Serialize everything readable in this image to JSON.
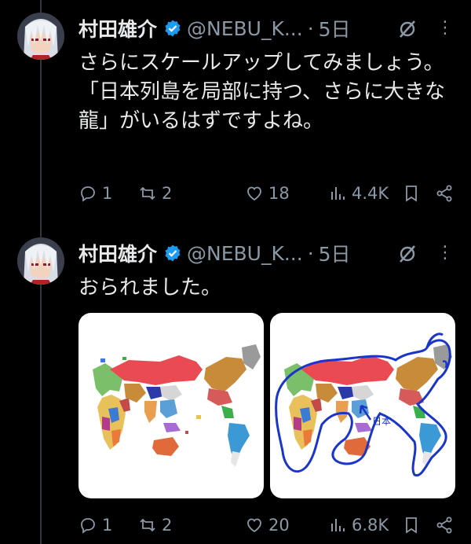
{
  "tweets": [
    {
      "author": {
        "name": "村田雄介",
        "handle": "@NEBU_K...",
        "time": "5日"
      },
      "separator": "·",
      "text": "さらにスケールアップしてみましょう。\n「日本列島を局部に持つ、さらに大きな龍」がいるはずですよね。",
      "stats": {
        "replies": "1",
        "reposts": "2",
        "likes": "18",
        "views": "4.4K"
      }
    },
    {
      "author": {
        "name": "村田雄介",
        "handle": "@NEBU_K...",
        "time": "5日"
      },
      "separator": "·",
      "text": "おられました。",
      "media_label": "日本",
      "stats": {
        "replies": "1",
        "reposts": "2",
        "likes": "20",
        "views": "6.8K"
      }
    }
  ],
  "colors": {
    "background": "#000000",
    "text": "#e7e9ea",
    "muted": "#8b98a5",
    "verified": "#1d9bf0",
    "annotation": "#1a35c8"
  },
  "icons": [
    "verified-badge-icon",
    "grok-icon",
    "more-icon",
    "reply-icon",
    "repost-icon",
    "like-icon",
    "views-icon",
    "bookmark-icon",
    "share-icon"
  ]
}
